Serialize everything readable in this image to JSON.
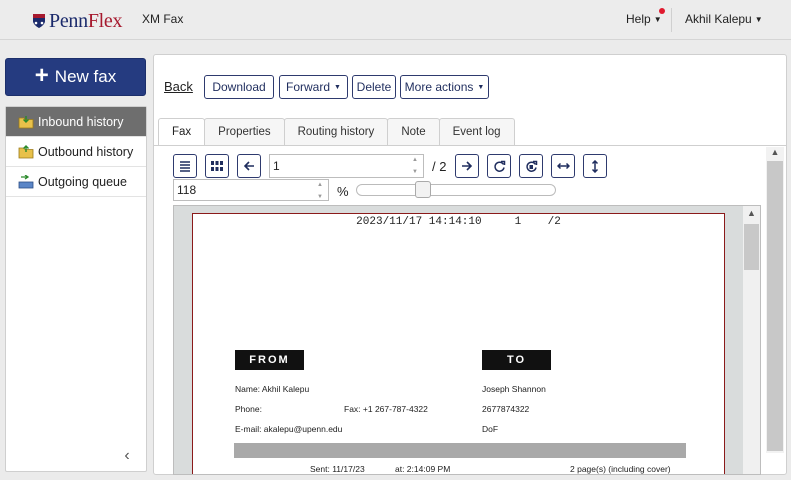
{
  "header": {
    "logo_text_a": "Penn",
    "logo_text_b": "Flex",
    "app_title": "XM Fax",
    "help_label": "Help",
    "user_name": "Akhil Kalepu"
  },
  "sidebar": {
    "new_fax_label": "New fax",
    "items": [
      {
        "label": "Inbound history",
        "icon": "inbox-folder-icon"
      },
      {
        "label": "Outbound history",
        "icon": "outbox-folder-icon"
      },
      {
        "label": "Outgoing queue",
        "icon": "queue-tray-icon"
      }
    ],
    "collapse_icon": "chevron-left-icon"
  },
  "toolbar": {
    "back_label": "Back",
    "download_label": "Download",
    "forward_label": "Forward",
    "delete_label": "Delete",
    "more_actions_label": "More actions"
  },
  "tabs": [
    "Fax",
    "Properties",
    "Routing history",
    "Note",
    "Event log"
  ],
  "viewer": {
    "page_number": "1",
    "page_total": "/ 2",
    "zoom_value": "118",
    "zoom_unit": "%",
    "zoom_level_fraction": 0.32
  },
  "fax_page": {
    "header_line": "2023/11/17 14:14:10     1    /2",
    "from_label": "FROM",
    "to_label": "TO",
    "from_name": "Name:   Akhil  Kalepu",
    "from_phone": "Phone:",
    "from_fax": "Fax:  +1 267-787-4322",
    "from_email": "E-mail:   akalepu@upenn.edu",
    "to_name": "Joseph Shannon",
    "to_phone": "2677874322",
    "to_org": "DoF",
    "sent_label": "Sent:   11/17/23",
    "at_label": "at:   2:14:09 PM",
    "pages_label": "2   page(s) (including cover)"
  },
  "colors": {
    "brand_navy": "#253b80",
    "brand_red": "#a6192e",
    "active_side": "#6e6e6e"
  }
}
